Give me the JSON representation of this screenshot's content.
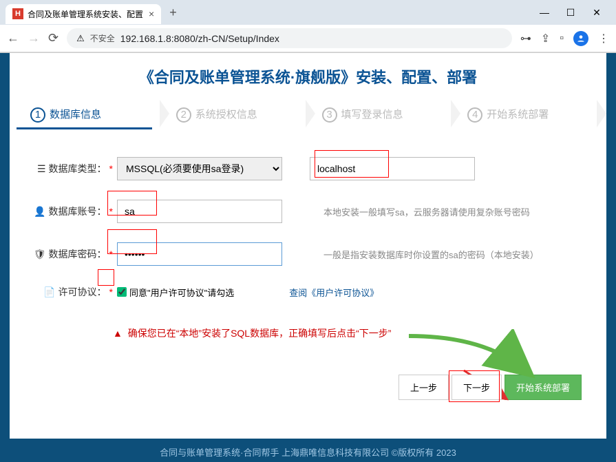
{
  "browser": {
    "tab_title": "合同及账单管理系统安装、配置",
    "url": "192.168.1.8:8080/zh-CN/Setup/Index",
    "insecure_label": "不安全"
  },
  "page": {
    "title": "《合同及账单管理系统·旗舰版》安装、配置、部署"
  },
  "steps": {
    "s1": "数据库信息",
    "s2": "系统授权信息",
    "s3": "填写登录信息",
    "s4": "开始系统部署"
  },
  "form": {
    "db_type_label": "数据库类型：",
    "db_type_value": "MSSQL(必须要使用sa登录)",
    "host_value": "localhost",
    "db_user_label": "数据库账号：",
    "db_user_value": "sa",
    "db_user_hint": "本地安装一般填写sa，云服务器请使用复杂账号密码",
    "db_pass_label": "数据库密码：",
    "db_pass_value": "••••••",
    "db_pass_hint": "一般是指安装数据库时你设置的sa的密码（本地安装）",
    "license_label": "许可协议：",
    "license_text": "同意\"用户许可协议\"请勾选",
    "license_link": "查阅《用户许可协议》"
  },
  "warning": "确保您已在“本地”安装了SQL数据库，正确填写后点击“下一步”",
  "buttons": {
    "prev": "上一步",
    "next": "下一步",
    "deploy": "开始系统部署"
  },
  "footer": "合同与账单管理系统·合同帮手  上海鼎唯信息科技有限公司 ©版权所有 2023"
}
